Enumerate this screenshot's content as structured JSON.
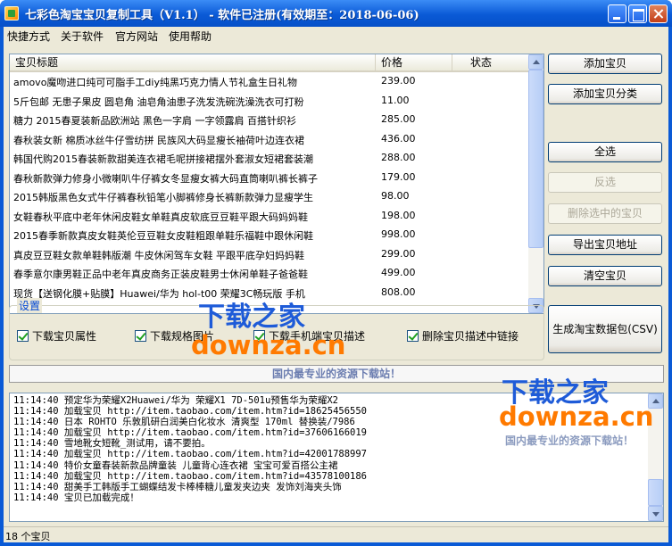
{
  "window": {
    "title": "七彩色淘宝宝贝复制工具（V1.1） - 软件已注册(有效期至：2018-06-06)"
  },
  "menu": [
    "快捷方式",
    "关于软件",
    "官方网站",
    "使用帮助"
  ],
  "table": {
    "columns": [
      "宝贝标题",
      "价格",
      "状态"
    ],
    "rows": [
      {
        "title": "amovo魔吻进口纯可可脂手工diy纯黑巧克力情人节礼盒生日礼物",
        "price": "239.00",
        "status": ""
      },
      {
        "title": "5斤包邮 无患子果皮 圆皂角 油皂角油患子洗发洗碗洗澡洗衣可打粉",
        "price": "11.00",
        "status": ""
      },
      {
        "title": "糖力 2015春夏装新品欧洲站 黑色一字肩 一字领露肩 百搭针织衫",
        "price": "285.00",
        "status": ""
      },
      {
        "title": "春秋装女新 棉质冰丝牛仔雪纺拼 民族风大码显瘦长袖荷叶边连衣裙",
        "price": "436.00",
        "status": ""
      },
      {
        "title": "韩国代购2015春装新款甜美连衣裙毛呢拼接裙摆外套淑女短裙套装潮",
        "price": "288.00",
        "status": ""
      },
      {
        "title": "春秋新款弹力修身小微喇叭牛仔裤女冬显瘦女裤大码直筒喇叭裤长裤子",
        "price": "179.00",
        "status": ""
      },
      {
        "title": "2015韩版黑色女式牛仔裤春秋铅笔小脚裤修身长裤新款弹力显瘦学生",
        "price": "98.00",
        "status": ""
      },
      {
        "title": "女鞋春秋平底中老年休闲皮鞋女单鞋真皮软底豆豆鞋平跟大码妈妈鞋",
        "price": "198.00",
        "status": ""
      },
      {
        "title": "2015春季新款真皮女鞋英伦豆豆鞋女皮鞋粗跟单鞋乐福鞋中跟休闲鞋",
        "price": "998.00",
        "status": ""
      },
      {
        "title": "真皮豆豆鞋女款单鞋韩版潮 牛皮休闲驾车女鞋 平跟平底孕妇妈妈鞋",
        "price": "299.00",
        "status": ""
      },
      {
        "title": "春季意尔康男鞋正品中老年真皮商务正装皮鞋男士休闲单鞋子爸爸鞋",
        "price": "499.00",
        "status": ""
      },
      {
        "title": "现货【送钢化膜+贴膜】Huawei/华为 hol-t00 荣耀3C畅玩版 手机",
        "price": "808.00",
        "status": ""
      }
    ]
  },
  "buttons": {
    "add_item": "添加宝贝",
    "add_category": "添加宝贝分类",
    "select_all": "全选",
    "invert": "反选",
    "delete_selected": "删除选中的宝贝",
    "export_urls": "导出宝贝地址",
    "clear": "清空宝贝",
    "generate_csv": "生成淘宝数据包(CSV)"
  },
  "settings": {
    "label": "设置",
    "options": [
      {
        "label": "下载宝贝属性",
        "checked": true
      },
      {
        "label": "下载规格图片",
        "checked": true
      },
      {
        "label": "下载手机端宝贝描述",
        "checked": true
      },
      {
        "label": "删除宝贝描述中链接",
        "checked": true
      }
    ]
  },
  "banner": "国内最专业的资源下载站！",
  "log": [
    "11:14:40 预定华为荣耀X2Huawei/华为 荣耀X1 7D-501u预售华为荣耀X2",
    "11:14:40 加载宝贝 http://item.taobao.com/item.htm?id=18625456550",
    "11:14:40 日本 ROHTO 乐敦肌研白润美白化妆水 清爽型 170ml 替换装/7986",
    "11:14:40 加载宝贝 http://item.taobao.com/item.htm?id=37606166019",
    "11:14:40 雪地靴女短靴_测试用，请不要拍。",
    "11:14:40 加载宝贝 http://item.taobao.com/item.htm?id=42001788997",
    "11:14:40 特价女童春装新款品牌童装 儿童背心连衣裙 宝宝可爱百搭公主裙",
    "11:14:40 加载宝贝 http://item.taobao.com/item.htm?id=43578100186",
    "11:14:40 甜美手工韩版手工蝴蝶结发卡棒棒糖儿童发夹边夹 发饰刘海夹头饰",
    "11:14:40 宝贝已加载完成！"
  ],
  "status": "18 个宝贝",
  "watermark": {
    "cn": "下载之家",
    "en": "downza.cn",
    "tag": "国内最专业的资源下载站！"
  }
}
